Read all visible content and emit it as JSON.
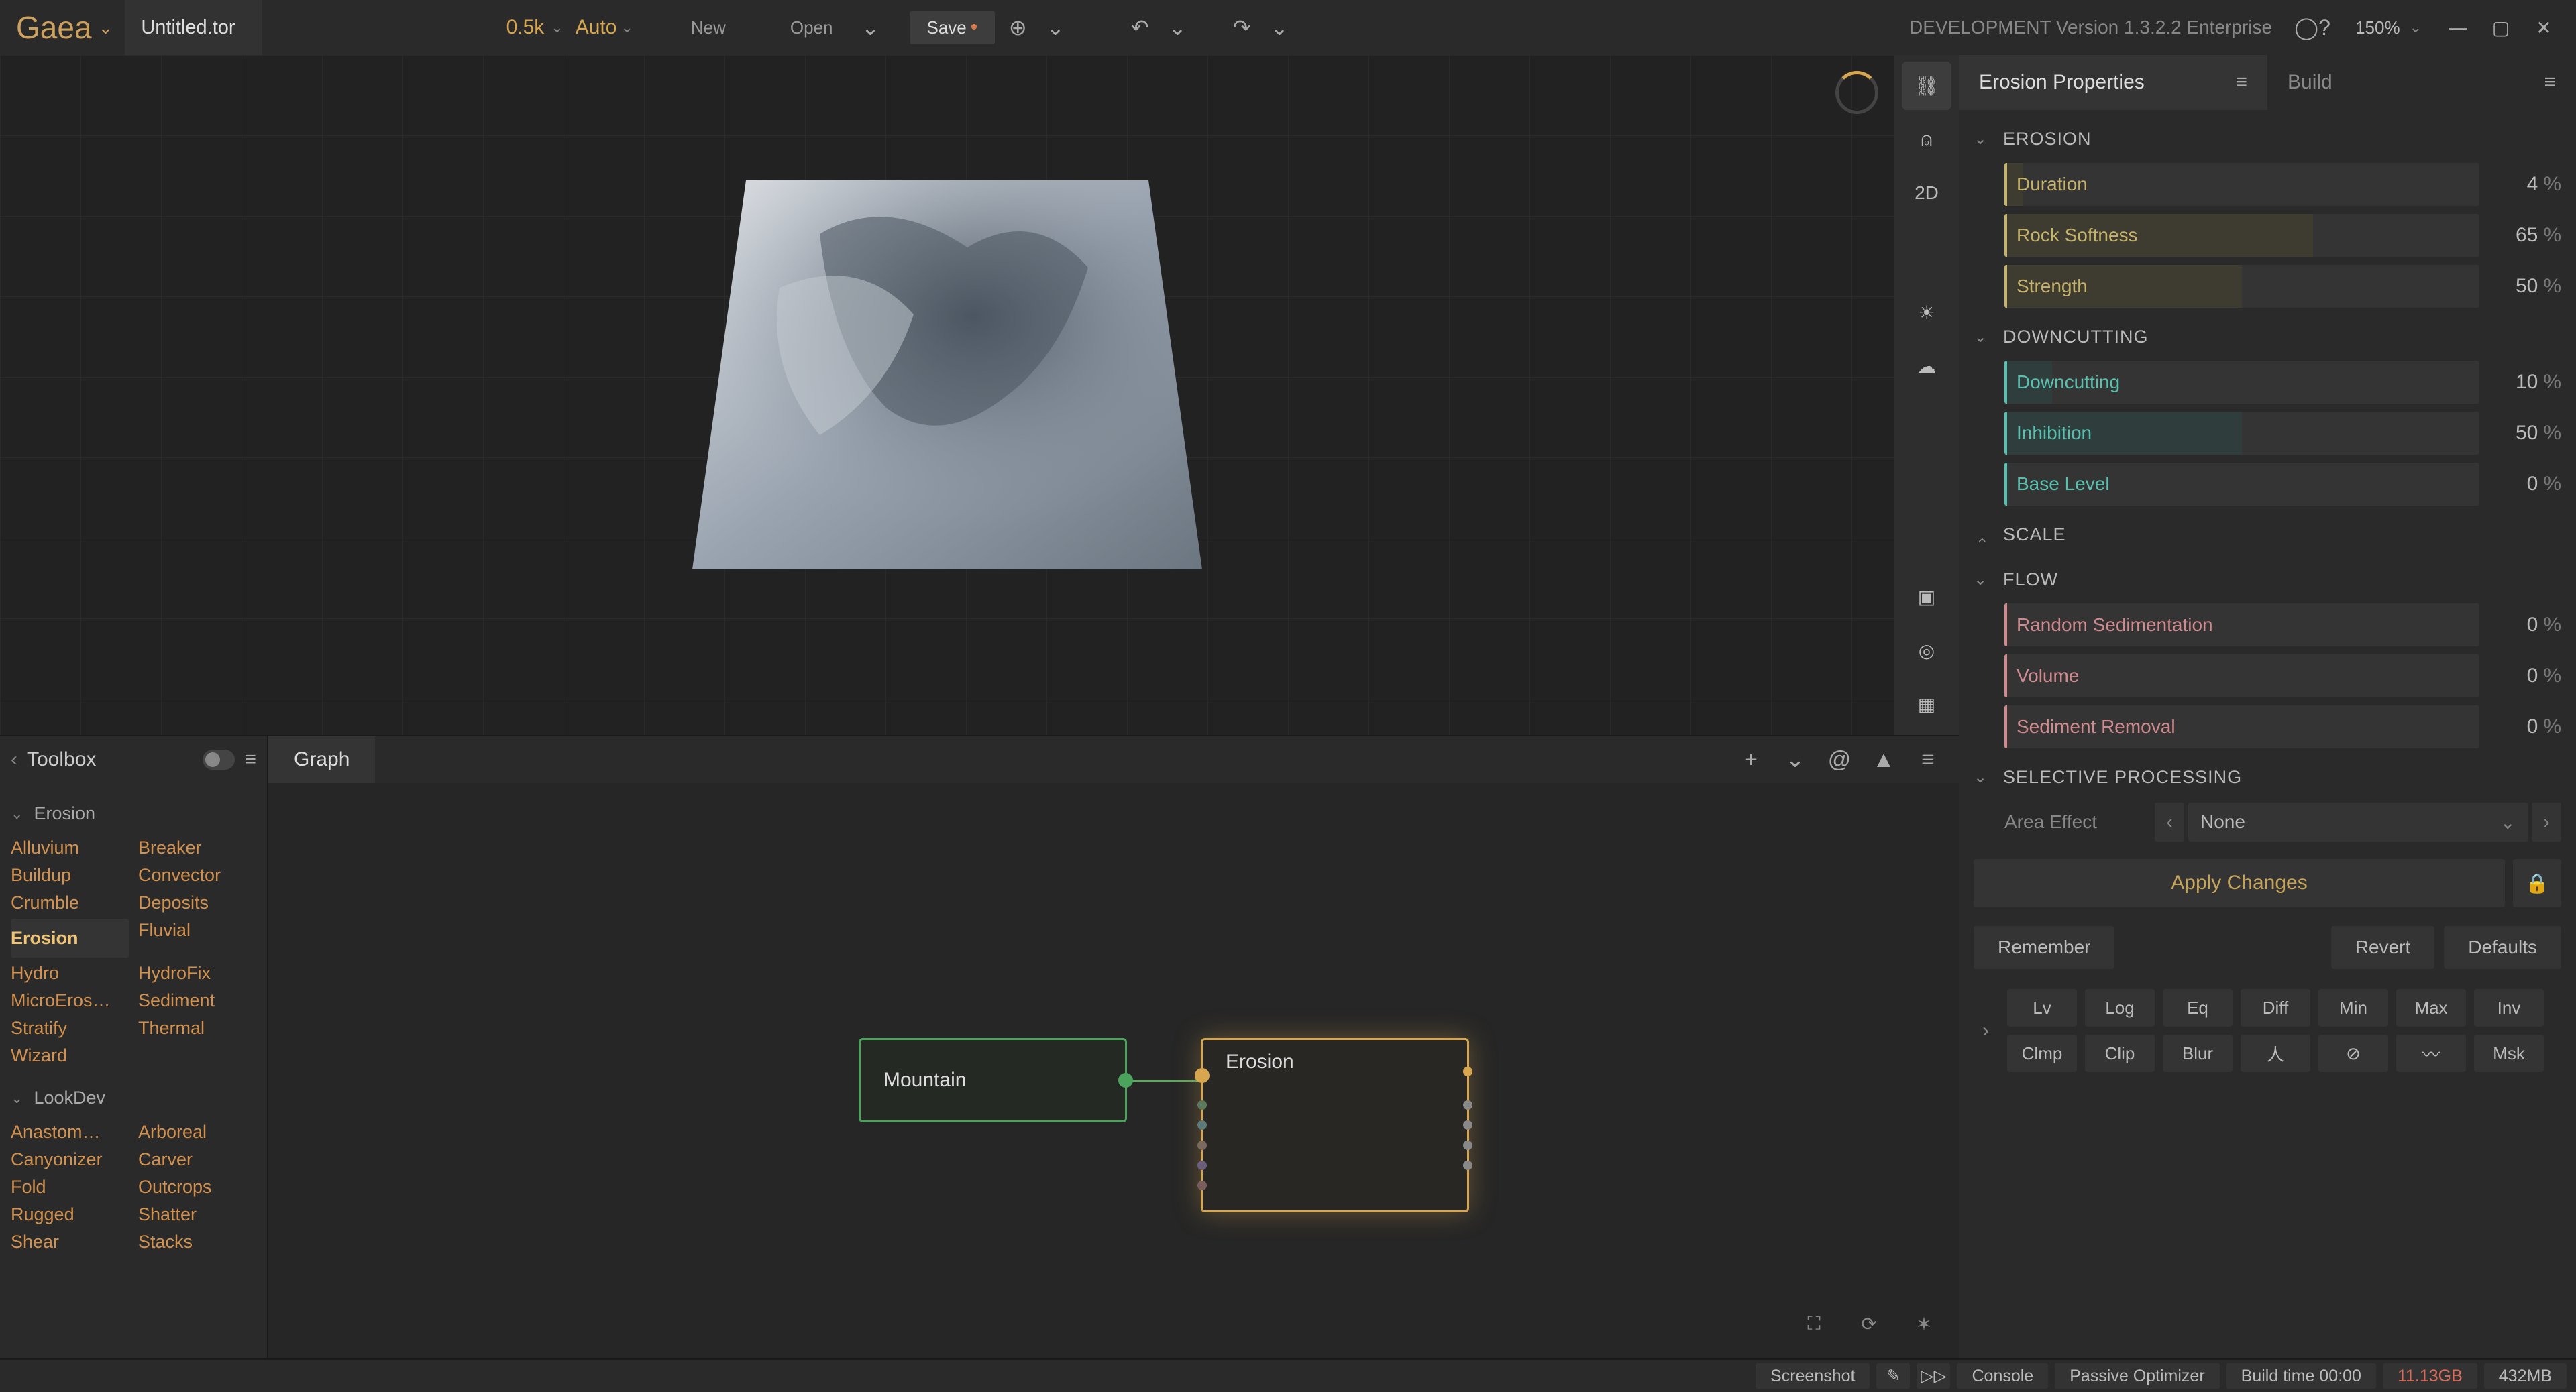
{
  "app": {
    "name": "Gaea",
    "doc": "Untitled.tor"
  },
  "topbar": {
    "res": "0.5k",
    "auto": "Auto",
    "new": "New",
    "open": "Open",
    "save": "Save",
    "dev": "DEVELOPMENT Version 1.3.2.2 Enterprise",
    "zoom": "150%"
  },
  "viewport_rail": {
    "mode2d": "2D"
  },
  "toolbox": {
    "title": "Toolbox",
    "groups": [
      {
        "name": "Erosion",
        "items": [
          "Alluvium",
          "Breaker",
          "Buildup",
          "Convector",
          "Crumble",
          "Deposits",
          "Erosion",
          "Fluvial",
          "Hydro",
          "HydroFix",
          "MicroEros…",
          "Sediment",
          "Stratify",
          "Thermal",
          "Wizard",
          ""
        ],
        "selected": "Erosion"
      },
      {
        "name": "LookDev",
        "items": [
          "Anastom…",
          "Arboreal",
          "Canyonizer",
          "Carver",
          "Fold",
          "Outcrops",
          "Rugged",
          "Shatter",
          "Shear",
          "Stacks"
        ],
        "selected": null
      }
    ]
  },
  "graph": {
    "tab": "Graph",
    "nodes": {
      "mountain": "Mountain",
      "erosion": "Erosion"
    }
  },
  "props": {
    "tab_props": "Erosion Properties",
    "tab_build": "Build",
    "groups": {
      "erosion": {
        "title": "EROSION",
        "items": [
          {
            "label": "Duration",
            "value": 4
          },
          {
            "label": "Rock Softness",
            "value": 65
          },
          {
            "label": "Strength",
            "value": 50
          }
        ]
      },
      "down": {
        "title": "DOWNCUTTING",
        "items": [
          {
            "label": "Downcutting",
            "value": 10
          },
          {
            "label": "Inhibition",
            "value": 50
          },
          {
            "label": "Base Level",
            "value": 0
          }
        ]
      },
      "scale": {
        "title": "SCALE"
      },
      "flow": {
        "title": "FLOW",
        "items": [
          {
            "label": "Random Sedimentation",
            "value": 0
          },
          {
            "label": "Volume",
            "value": 0
          },
          {
            "label": "Sediment Removal",
            "value": 0
          }
        ]
      },
      "sel": {
        "title": "SELECTIVE PROCESSING",
        "area_label": "Area Effect",
        "area_value": "None"
      }
    },
    "apply": "Apply Changes",
    "remember": "Remember",
    "revert": "Revert",
    "defaults": "Defaults",
    "chips": [
      [
        "Lv",
        "Log",
        "Eq",
        "Diff",
        "Min",
        "Max",
        "Inv"
      ],
      [
        "Clmp",
        "Clip",
        "Blur",
        "人",
        "⊘",
        "〰",
        "Msk"
      ]
    ]
  },
  "status": {
    "screenshot": "Screenshot",
    "console": "Console",
    "passive": "Passive Optimizer",
    "build": "Build time 00:00",
    "mem_gpu": "11.13GB",
    "mem_ram": "432MB"
  }
}
